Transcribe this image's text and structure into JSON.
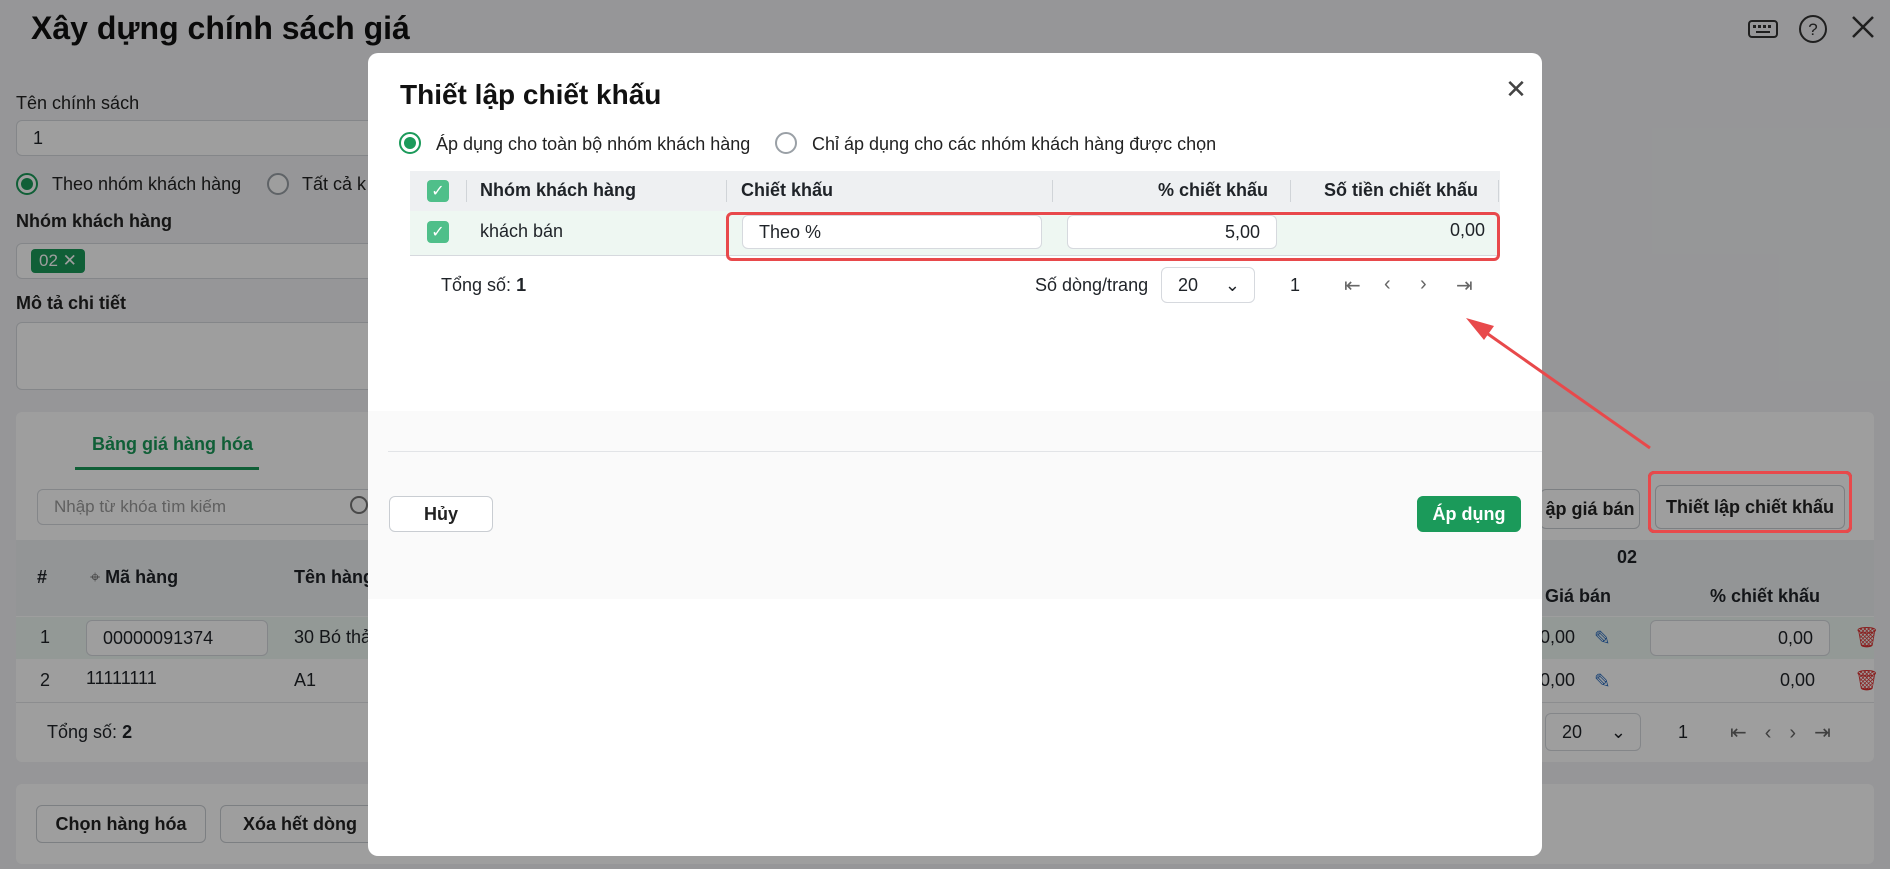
{
  "page": {
    "title": "Xây dựng chính sách giá",
    "policy_name_label": "Tên chính sách",
    "policy_name_value": "1",
    "radio_group_label": "Theo nhóm khách hàng",
    "radio_all_label": "Tất cả k",
    "customer_group_label": "Nhóm khách hàng",
    "customer_group_chip": "02",
    "description_label": "Mô tả chi tiết",
    "tab_label": "Bảng giá hàng hóa",
    "search_placeholder": "Nhập từ khóa tìm kiếm",
    "btn_set_price": "ập giá bán",
    "btn_set_discount": "Thiết lập chiết khấu",
    "table": {
      "col_hash": "#",
      "col_code": "Mã hàng",
      "col_name": "Tên hàng",
      "group_header": "02",
      "col_price": "Giá bán",
      "col_discount_pct": "% chiết khấu",
      "rows": [
        {
          "index": "1",
          "code": "00000091374",
          "name": "30 Bó thả",
          "price": "0,00",
          "discount": "0,00"
        },
        {
          "index": "2",
          "code": "11111111",
          "name": "A1",
          "price": "0,00",
          "discount": "0,00"
        }
      ]
    },
    "total_label": "Tổng số:",
    "total_value": "2",
    "page_size": "20",
    "page_number": "1",
    "btn_choose_goods": "Chọn hàng hóa",
    "btn_delete_rows": "Xóa hết dòng"
  },
  "dialog": {
    "title": "Thiết lập chiết khấu",
    "radio_all": "Áp dụng cho toàn bộ nhóm khách hàng",
    "radio_selected": "Chỉ áp dụng cho các nhóm khách hàng được chọn",
    "table": {
      "col_group": "Nhóm khách hàng",
      "col_discount": "Chiết khấu",
      "col_pct": "% chiết khấu",
      "col_amount": "Số tiền chiết khấu",
      "rows": [
        {
          "group": "khách bán",
          "discount_type": "Theo %",
          "pct": "5,00",
          "amount": "0,00"
        }
      ]
    },
    "total_label": "Tổng số:",
    "total_value": "1",
    "rows_per_page_label": "Số dòng/trang",
    "page_size": "20",
    "page_number": "1",
    "btn_cancel": "Hủy",
    "btn_apply": "Áp dụng"
  },
  "colors": {
    "accent": "#1b9a5a",
    "annotation": "#e8494b"
  }
}
